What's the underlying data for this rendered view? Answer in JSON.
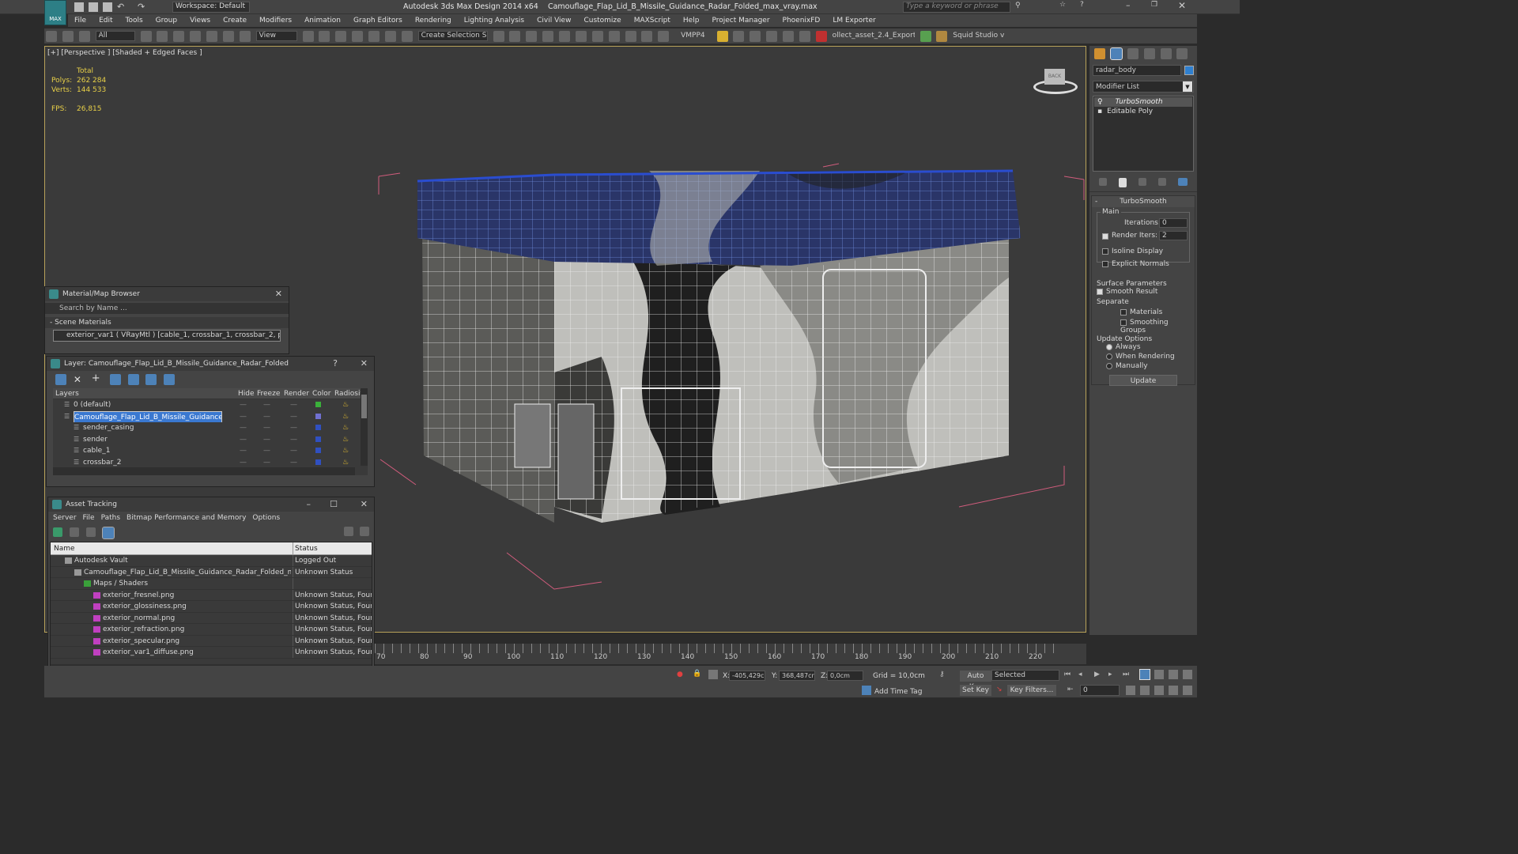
{
  "app": {
    "title": "Autodesk 3ds Max Design 2014 x64",
    "file": "Camouflage_Flap_Lid_B_Missile_Guidance_Radar_Folded_max_vray.max",
    "workspace": "Workspace: Default",
    "search_placeholder": "Type a keyword or phrase",
    "logo": "MAX"
  },
  "menu": [
    "File",
    "Edit",
    "Tools",
    "Group",
    "Views",
    "Create",
    "Modifiers",
    "Animation",
    "Graph Editors",
    "Rendering",
    "Lighting Analysis",
    "Civil View",
    "Customize",
    "MAXScript",
    "Help",
    "Project Manager",
    "PhoenixFD",
    "LM Exporter"
  ],
  "toolbar": {
    "filter": "All",
    "refcoord": "View",
    "selset": "Create Selection Se",
    "vmpp": "VMPP4",
    "exporter": "ollect_asset_2.4_Exporter",
    "squid": "Squid Studio v"
  },
  "viewport": {
    "label": "[+] [Perspective ] [Shaded + Edged Faces ]",
    "stats_title": "Total",
    "polys_label": "Polys:",
    "polys": "262 284",
    "verts_label": "Verts:",
    "verts": "144 533",
    "fps_label": "FPS:",
    "fps": "26,815"
  },
  "material_browser": {
    "title": "Material/Map Browser",
    "search": "Search by Name ...",
    "section": "- Scene Materials",
    "item": "exterior_var1  ( VRayMtl ) [cable_1, crossbar_1, crossbar_2, plung..."
  },
  "layer": {
    "title": "Layer: Camouflage_Flap_Lid_B_Missile_Guidance_Radar_Folded",
    "cols": [
      "Layers",
      "Hide",
      "Freeze",
      "Render",
      "Color",
      "Radiosit"
    ],
    "rows": [
      {
        "name": "0 (default)",
        "color": "#3ab03a",
        "indent": 1,
        "selected": false
      },
      {
        "name": "Camouflage_Flap_Lid_B_Missile_Guidance_Radar_",
        "color": "#7070d0",
        "indent": 1,
        "selected": true
      },
      {
        "name": "sender_casing",
        "color": "#3050c0",
        "indent": 2,
        "selected": false
      },
      {
        "name": "sender",
        "color": "#3050c0",
        "indent": 2,
        "selected": false
      },
      {
        "name": "cable_1",
        "color": "#3050c0",
        "indent": 2,
        "selected": false
      },
      {
        "name": "crossbar_2",
        "color": "#3050c0",
        "indent": 2,
        "selected": false
      }
    ]
  },
  "asset": {
    "title": "Asset Tracking",
    "menu": [
      "Server",
      "File",
      "Paths",
      "Bitmap Performance and Memory",
      "Options"
    ],
    "col_name": "Name",
    "col_status": "Status",
    "rows": [
      {
        "name": "Autodesk Vault",
        "status": "Logged Out",
        "indent": 1
      },
      {
        "name": "Camouflage_Flap_Lid_B_Missile_Guidance_Radar_Folded_m...",
        "status": "Unknown Status",
        "indent": 2
      },
      {
        "name": "Maps / Shaders",
        "status": "",
        "indent": 3
      },
      {
        "name": "exterior_fresnel.png",
        "status": "Unknown Status, Found",
        "indent": 4
      },
      {
        "name": "exterior_glossiness.png",
        "status": "Unknown Status, Found",
        "indent": 4
      },
      {
        "name": "exterior_normal.png",
        "status": "Unknown Status, Found",
        "indent": 4
      },
      {
        "name": "exterior_refraction.png",
        "status": "Unknown Status, Found",
        "indent": 4
      },
      {
        "name": "exterior_specular.png",
        "status": "Unknown Status, Found",
        "indent": 4
      },
      {
        "name": "exterior_var1_diffuse.png",
        "status": "Unknown Status, Found",
        "indent": 4
      }
    ]
  },
  "cmd": {
    "object_name": "radar_body",
    "modifier_list": "Modifier List",
    "stack": [
      "TurboSmooth",
      "Editable Poly"
    ],
    "rollout": "TurboSmooth",
    "main": "Main",
    "iterations_label": "Iterations:",
    "iterations": "0",
    "render_iters_label": "Render Iters:",
    "render_iters": "2",
    "isoline": "Isoline Display",
    "explicit": "Explicit Normals",
    "surface": "Surface Parameters",
    "smooth": "Smooth Result",
    "separate": "Separate",
    "materials": "Materials",
    "smoothing": "Smoothing Groups",
    "update_opts": "Update Options",
    "always": "Always",
    "when_rendering": "When Rendering",
    "manually": "Manually",
    "update_btn": "Update"
  },
  "timeline": {
    "ticks": [
      "70",
      "80",
      "90",
      "100",
      "110",
      "120",
      "130",
      "140",
      "150",
      "160",
      "170",
      "180",
      "190",
      "200",
      "210",
      "220"
    ]
  },
  "status": {
    "x_label": "X:",
    "x": "-405,429cr",
    "y_label": "Y:",
    "y": "368,487cr",
    "z_label": "Z:",
    "z": "0,0cm",
    "grid": "Grid = 10,0cm",
    "autokey": "Auto Key",
    "selected": "Selected",
    "setkey": "Set Key",
    "keyfilters": "Key Filters...",
    "frame": "0",
    "addtime": "Add Time Tag"
  },
  "view_cube_label": "BACK"
}
